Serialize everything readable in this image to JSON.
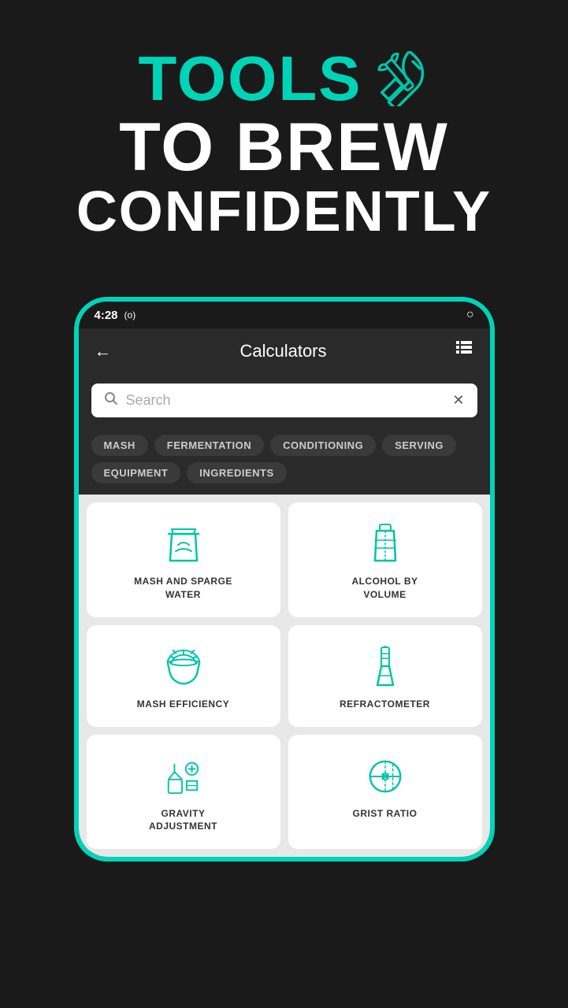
{
  "hero": {
    "line1": "TOOLS",
    "line2": "TO BREW",
    "line3": "CONFIDENTLY"
  },
  "status_bar": {
    "time": "4:28",
    "signal": "(o)",
    "battery": "○"
  },
  "app_header": {
    "back_label": "←",
    "title": "Calculators",
    "grid_icon": "⊞"
  },
  "search": {
    "placeholder": "Search",
    "clear_icon": "✕"
  },
  "filter_tags": [
    "MASH",
    "FERMENTATION",
    "CONDITIONING",
    "SERVING",
    "EQUIPMENT",
    "INGREDIENTS"
  ],
  "calculators": [
    {
      "id": "mash-sparge",
      "label": "MASH AND SPARGE\nWATER",
      "icon": "mash-icon"
    },
    {
      "id": "abv",
      "label": "ALCOHOL BY\nVOLUME",
      "icon": "abv-icon"
    },
    {
      "id": "mash-efficiency",
      "label": "MASH EFFICIENCY",
      "icon": "efficiency-icon"
    },
    {
      "id": "refractometer",
      "label": "REFRACTOMETER",
      "icon": "refractometer-icon"
    },
    {
      "id": "gravity-adjustment",
      "label": "GRAVITY\nADJUSTMENT",
      "icon": "gravity-icon"
    },
    {
      "id": "grist-ratio",
      "label": "GRIST RATIO",
      "icon": "grist-icon"
    }
  ],
  "colors": {
    "teal": "#00c4a8",
    "dark_bg": "#1a1a1a",
    "card_bg": "#ffffff",
    "tag_bg": "#3a3a3a"
  }
}
